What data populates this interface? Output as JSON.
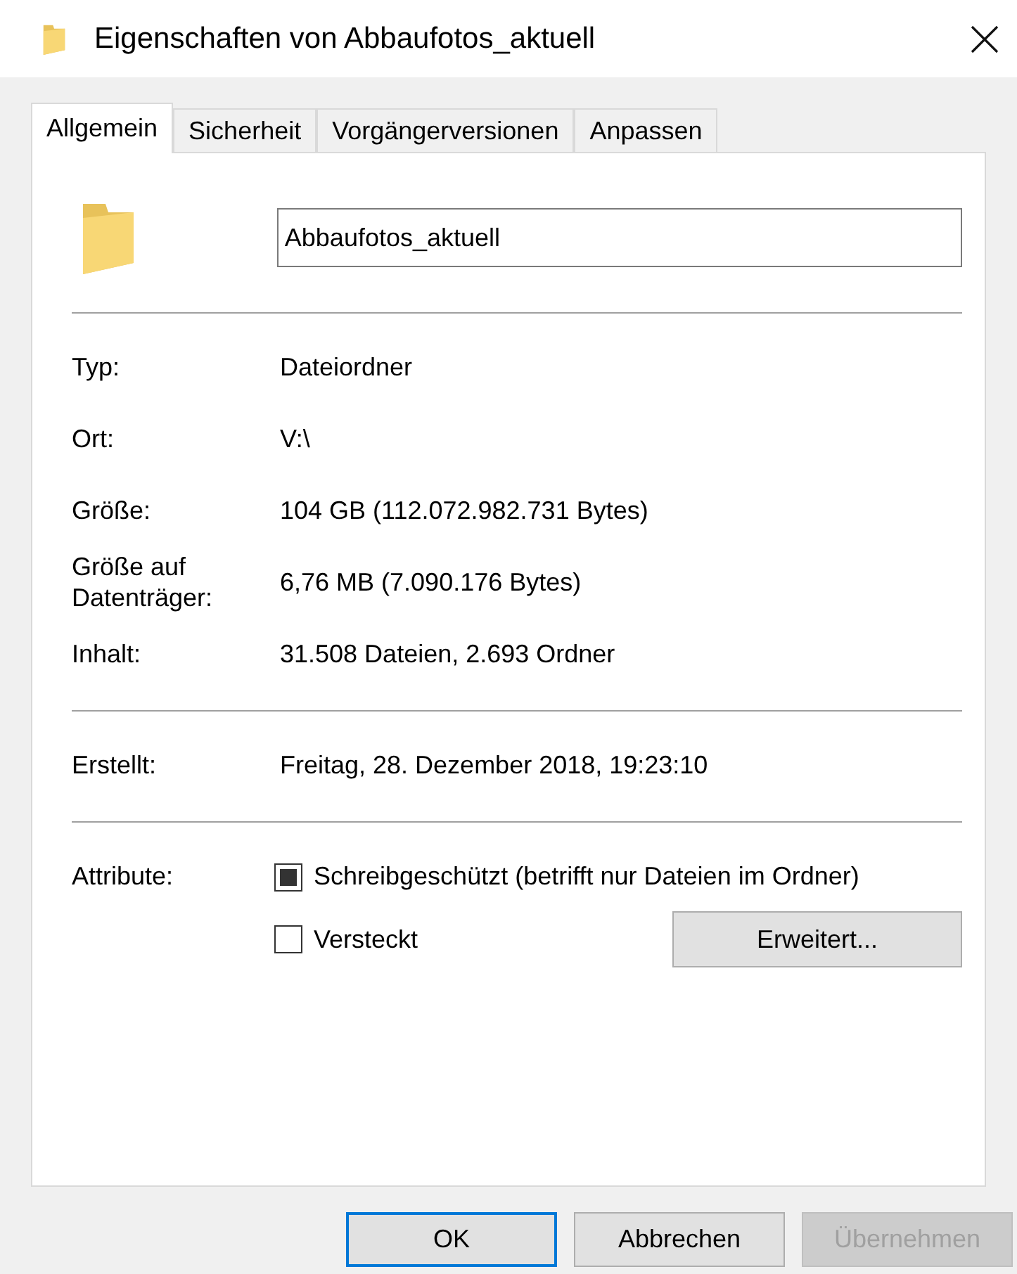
{
  "window": {
    "title": "Eigenschaften von Abbaufotos_aktuell"
  },
  "tabs": [
    {
      "label": "Allgemein",
      "selected": true
    },
    {
      "label": "Sicherheit",
      "selected": false
    },
    {
      "label": "Vorgängerversionen",
      "selected": false
    },
    {
      "label": "Anpassen",
      "selected": false
    }
  ],
  "name_field": {
    "value": "Abbaufotos_aktuell"
  },
  "sections": [
    [
      {
        "label": "Typ:",
        "value": "Dateiordner"
      },
      {
        "label": "Ort:",
        "value": "V:\\"
      },
      {
        "label": "Größe:",
        "value": "104 GB (112.072.982.731 Bytes)"
      },
      {
        "label": "Größe auf Datenträger:",
        "value": "6,76 MB (7.090.176 Bytes)"
      },
      {
        "label": "Inhalt:",
        "value": "31.508 Dateien, 2.693 Ordner"
      }
    ],
    [
      {
        "label": "Erstellt:",
        "value": "Freitag, 28. Dezember 2018, 19:23:10"
      }
    ]
  ],
  "attributes": {
    "label": "Attribute:",
    "items": [
      {
        "label": "Schreibgeschützt (betrifft nur Dateien im Ordner)",
        "checked": false,
        "indeterminate": true
      },
      {
        "label": "Versteckt",
        "checked": false,
        "indeterminate": false
      }
    ],
    "advanced_button": "Erweitert..."
  },
  "buttons": [
    {
      "label": "OK",
      "default": true,
      "disabled": false
    },
    {
      "label": "Abbrechen",
      "default": false,
      "disabled": false
    },
    {
      "label": "Übernehmen",
      "default": false,
      "disabled": true
    }
  ]
}
